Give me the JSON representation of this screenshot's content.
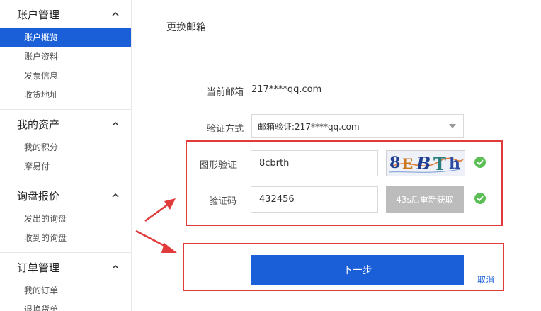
{
  "sidebar": {
    "groups": [
      {
        "title": "账户管理",
        "items": [
          "账户概览",
          "账户资料",
          "发票信息",
          "收货地址"
        ]
      },
      {
        "title": "我的资产",
        "items": [
          "我的积分",
          "摩易付"
        ]
      },
      {
        "title": "询盘报价",
        "items": [
          "发出的询盘",
          "收到的询盘"
        ]
      },
      {
        "title": "订单管理",
        "items": [
          "我的订单",
          "退换货单"
        ]
      }
    ],
    "active_item": "账户概览"
  },
  "main": {
    "title": "更换邮箱",
    "current_email_label": "当前邮箱",
    "current_email_value": "217****qq.com",
    "verify_method_label": "验证方式",
    "verify_method_value": "邮箱验证:217****qq.com",
    "captcha_label": "图形验证",
    "captcha_input_value": "8cbrth",
    "captcha_image_text": "8EBTh",
    "code_label": "验证码",
    "code_input_value": "432456",
    "resend_label": "43s后重新获取",
    "next_label": "下一步",
    "cancel_label": "取消"
  },
  "colors": {
    "primary": "#1a5fd7",
    "success": "#5bbf55",
    "annotation": "#e03a3a",
    "disabled": "#bcbcbc"
  },
  "icons": [
    "chevron-up-icon",
    "dropdown-arrow-icon",
    "check-circle-icon",
    "arrow-annotation"
  ]
}
